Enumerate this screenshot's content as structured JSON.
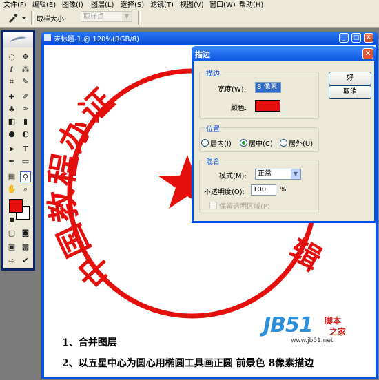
{
  "menu": {
    "items": [
      "文件(F)",
      "编辑(E)",
      "图像(I)",
      "图层(L)",
      "选择(S)",
      "滤镜(T)",
      "视图(V)",
      "窗口(W)",
      "帮助(H)"
    ]
  },
  "options_bar": {
    "sample_size_label": "取样大小:",
    "sample_size_value": "取样点"
  },
  "document": {
    "title": "未标题-1 @ 120%(RGB/8)"
  },
  "seal": {
    "text": "中国教程办证",
    "text_right": "辑",
    "color": "#e3100e"
  },
  "captions": {
    "line1": "1、合并图层",
    "line2": "2、以五星中心为圆心用椭圆工具画正圆  前景色  8像素描边"
  },
  "watermark": {
    "brand": "JB51",
    "tag1": "脚本",
    "tag2": "之家",
    "url": "www.jb51.net"
  },
  "dialog": {
    "title": "描边",
    "ok_label": "好",
    "cancel_label": "取消",
    "stroke_group": "描边",
    "width_label": "宽度(W):",
    "width_value": "8 像素",
    "color_label": "颜色:",
    "color_value": "#e3100e",
    "location_group": "位置",
    "location_options": [
      "居内(I)",
      "居中(C)",
      "居外(U)"
    ],
    "location_selected": "居中(C)",
    "blend_group": "混合",
    "mode_label": "模式(M):",
    "mode_value": "正常",
    "opacity_label": "不透明度(O):",
    "opacity_value": "100",
    "opacity_unit": "%",
    "preserve_label": "保留透明区域(P)"
  },
  "colors": {
    "foreground": "#e3100e",
    "background": "#ffffff",
    "title_blue": "#0054e3"
  }
}
